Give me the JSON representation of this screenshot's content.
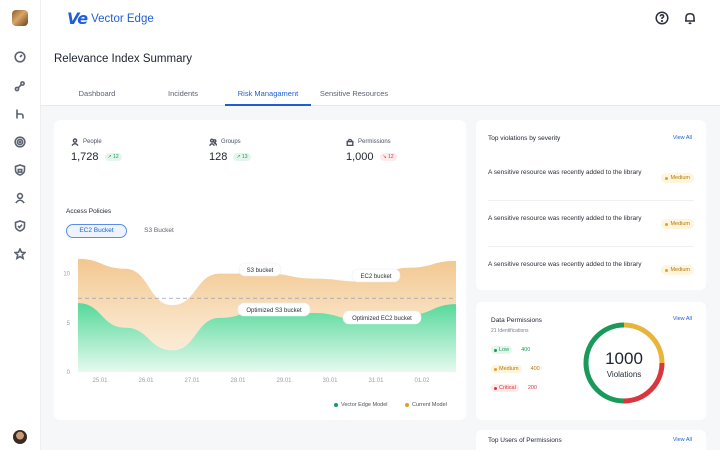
{
  "app": {
    "logo_mark": "Ve",
    "name": "Vector Edge"
  },
  "header": {
    "title": "Relevance Index Summary",
    "tabs": [
      {
        "label": "Dashboard",
        "active": false
      },
      {
        "label": "Incidents",
        "active": false
      },
      {
        "label": "Risk Managament",
        "active": true
      },
      {
        "label": "Sensitive Resources",
        "active": false
      }
    ]
  },
  "topbar_icons": [
    "help-icon",
    "bell-icon"
  ],
  "sidebar_icons": [
    "dashboard-icon",
    "connections-icon",
    "branch-icon",
    "target-icon",
    "shield-lock-icon",
    "user-icon",
    "shield-check-icon",
    "star-icon"
  ],
  "stats": [
    {
      "label": "People",
      "icon": "user-icon",
      "value": "1,728",
      "delta": "12",
      "trend": "up"
    },
    {
      "label": "Groups",
      "icon": "users-icon",
      "value": "128",
      "delta": "13",
      "trend": "up"
    },
    {
      "label": "Permissions",
      "icon": "lock-icon",
      "value": "1,000",
      "delta": "12",
      "trend": "down"
    }
  ],
  "access_policies": {
    "title": "Access Policies",
    "segments": [
      "EC2 Bucket",
      "S3 Bucket"
    ],
    "active_segment": "EC2 Bucket"
  },
  "chart_data": {
    "type": "area",
    "x": [
      "25.01",
      "26.01",
      "27.01",
      "28.01",
      "29.01",
      "30.01",
      "31.01",
      "01.02"
    ],
    "yticks": [
      "0",
      "5",
      "10"
    ],
    "ylim": [
      0,
      12
    ],
    "threshold": 7.5,
    "series": [
      {
        "name": "Current Model",
        "color": "#e9a84a",
        "values": [
          11.5,
          10.5,
          6.8,
          10.0,
          10.0,
          9.5,
          9.2,
          10.6,
          11.3
        ]
      },
      {
        "name": "Vector Edge Model",
        "color": "#34c983",
        "values": [
          7.0,
          4.5,
          2.2,
          5.5,
          6.4,
          6.0,
          5.3,
          5.8,
          6.9
        ]
      }
    ],
    "annotations": [
      "S3 bucket",
      "EC2 bucket",
      "Optimized S3 bucket",
      "Optimized EC2 bucket"
    ]
  },
  "legend": [
    {
      "label": "Vector Edge Model",
      "color": "#1a9a5a"
    },
    {
      "label": "Current Model",
      "color": "#e0a020"
    }
  ],
  "top_violations": {
    "title": "Top violations by severity",
    "view_all": "View All",
    "items": [
      {
        "text": "A sensitive resource was recently added to the library",
        "severity": "Medium"
      },
      {
        "text": "A sensitive resource was recently added to the library",
        "severity": "Medium"
      },
      {
        "text": "A sensitive resource was recently added to the library",
        "severity": "Medium"
      }
    ]
  },
  "data_permissions": {
    "title": "Data Permissions",
    "subtitle": "21 Identifications",
    "view_all": "View All",
    "levels": [
      {
        "label": "Low",
        "count": "400",
        "color": "#1a9a5a",
        "bg": "#e4f6ec"
      },
      {
        "label": "Medium",
        "count": "400",
        "color": "#b07a0b",
        "bg": "#fff4dc"
      },
      {
        "label": "Critical",
        "count": "200",
        "color": "#d9363e",
        "bg": "#fdeaea"
      }
    ],
    "donut_value": "1000",
    "donut_label": "Violations",
    "donut_colors": [
      "#1a9a5a",
      "#e8b53a",
      "#d9363e"
    ]
  },
  "top_users": {
    "title": "Top Users of Permissions",
    "view_all": "View All"
  }
}
